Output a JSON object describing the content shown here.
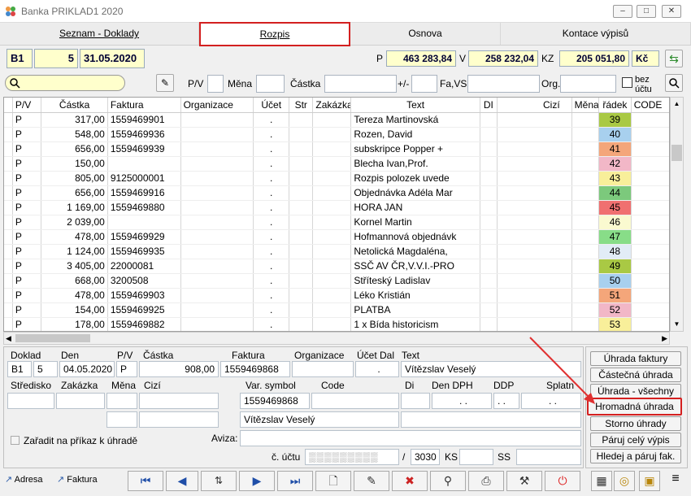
{
  "window": {
    "title": "Banka PRIKLAD1  2020"
  },
  "tabs": [
    "Seznam - Doklady",
    "Rozpis",
    "Osnova",
    "Kontace výpisů"
  ],
  "header": {
    "series": "B1",
    "number": "5",
    "date": "31.05.2020",
    "p_label": "P",
    "p_value": "463 283,84",
    "v_label": "V",
    "v_value": "258 232,04",
    "kz_label": "KZ",
    "kz_value": "205 051,80",
    "currency": "Kč"
  },
  "filter": {
    "pv": "P/V",
    "mena": "Měna",
    "castka": "Částka",
    "pm": "+/-",
    "favs": "Fa,VS",
    "org": "Org.",
    "bez": "bez",
    "uctu": "účtu"
  },
  "columns": [
    "P/V",
    "Částka",
    "Faktura",
    "Organizace",
    "Účet",
    "Str",
    "Zakázka",
    "Text",
    "DI",
    "Cizí",
    "Měna",
    "řádek",
    "CODE"
  ],
  "rows": [
    {
      "pv": "P",
      "castka": "317,00",
      "faktura": "1559469901",
      "ucet": ".",
      "text": "Tereza Martinovská",
      "radek": "39",
      "color": "#a9c944"
    },
    {
      "pv": "P",
      "castka": "548,00",
      "faktura": "1559469936",
      "ucet": ".",
      "text": "Rozen, David",
      "radek": "40",
      "color": "#a8d0ee"
    },
    {
      "pv": "P",
      "castka": "656,00",
      "faktura": "1559469939",
      "ucet": ".",
      "text": "subskripce Popper +",
      "radek": "41",
      "color": "#f4a67a"
    },
    {
      "pv": "P",
      "castka": "150,00",
      "faktura": "",
      "ucet": ".",
      "text": "Blecha Ivan,Prof.",
      "radek": "42",
      "color": "#f2b7c7"
    },
    {
      "pv": "P",
      "castka": "805,00",
      "faktura": "9125000001",
      "ucet": ".",
      "text": "Rozpis polozek uvede",
      "radek": "43",
      "color": "#f8ef9a"
    },
    {
      "pv": "P",
      "castka": "656,00",
      "faktura": "1559469916",
      "ucet": ".",
      "text": "Objednávka Adéla Mar",
      "radek": "44",
      "color": "#7cc97c"
    },
    {
      "pv": "P",
      "castka": "1 169,00",
      "faktura": "1559469880",
      "ucet": ".",
      "text": "HORA JAN",
      "radek": "45",
      "color": "#f07070"
    },
    {
      "pv": "P",
      "castka": "2 039,00",
      "faktura": "",
      "ucet": ".",
      "text": "Kornel Martin",
      "radek": "46",
      "color": "#fafad0"
    },
    {
      "pv": "P",
      "castka": "478,00",
      "faktura": "1559469929",
      "ucet": ".",
      "text": "Hofmannová objednávk",
      "radek": "47",
      "color": "#88dd88"
    },
    {
      "pv": "P",
      "castka": "1 124,00",
      "faktura": "1559469935",
      "ucet": ".",
      "text": "Netolická Magdaléna,",
      "radek": "48",
      "color": "#e2ecf6"
    },
    {
      "pv": "P",
      "castka": "3 405,00",
      "faktura": "22000081",
      "ucet": ".",
      "text": "SSČ AV ČR,V.V.I.-PRO",
      "radek": "49",
      "color": "#a9c944"
    },
    {
      "pv": "P",
      "castka": "668,00",
      "faktura": "3200508",
      "ucet": ".",
      "text": "Stříteský Ladislav",
      "radek": "50",
      "color": "#a8d0ee"
    },
    {
      "pv": "P",
      "castka": "478,00",
      "faktura": "1559469903",
      "ucet": ".",
      "text": "Léko Kristián",
      "radek": "51",
      "color": "#f4a67a"
    },
    {
      "pv": "P",
      "castka": "154,00",
      "faktura": "1559469925",
      "ucet": ".",
      "text": "PLATBA",
      "radek": "52",
      "color": "#f2b7c7"
    },
    {
      "pv": "P",
      "castka": "178,00",
      "faktura": "1559469882",
      "ucet": ".",
      "text": "1 x Bída historicism",
      "radek": "53",
      "color": "#f8ef9a"
    }
  ],
  "detail": {
    "doklad_label": "Doklad",
    "den_label": "Den",
    "pv_label": "P/V",
    "castka_label": "Částka",
    "faktura_label": "Faktura",
    "org_label": "Organizace",
    "ucet_label": "Účet Dal",
    "text_label": "Text",
    "doklad_series": "B1",
    "doklad_num": "5",
    "den": "04.05.2020",
    "pv": "P",
    "castka": "908,00",
    "faktura": "1559469868",
    "ucet": ".",
    "text": "Vítězslav Veselý",
    "stredisko_label": "Středisko",
    "zakazka_label": "Zakázka",
    "mena_label": "Měna",
    "cizi_label": "Cizí",
    "vs_label": "Var. symbol",
    "code_label": "Code",
    "di_label": "Di",
    "dph_label": "Den DPH",
    "ddp_label": "DDP",
    "splatno_label": "Splatn",
    "vs": "1559469868",
    "dph": ". .",
    "ddp": ". .",
    "name": "Vítězslav Veselý",
    "zaradit": "Zařadit na příkaz k úhradě",
    "aviza_label": "Aviza:",
    "cucet_label": "č. účtu",
    "slash": "/",
    "bank": "3030",
    "ks_label": "KS",
    "ss_label": "SS"
  },
  "actions": [
    "Úhrada faktury",
    "Částečná úhrada",
    "Úhrada - všechny",
    "Hromadná úhrada",
    "Storno úhrady",
    "Páruj celý výpis",
    "Hledej a páruj fak."
  ],
  "bottom": {
    "adresa": "Adresa",
    "faktura": "Faktura"
  }
}
